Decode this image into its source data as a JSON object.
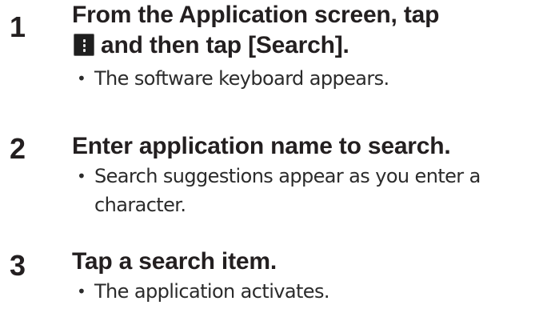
{
  "steps": [
    {
      "number": "1",
      "title_line_1": "From the Application screen, tap",
      "title_line_2_suffix": "and then tap [Search].",
      "icon": "menu-overflow-icon",
      "notes": [
        "The software keyboard appears."
      ]
    },
    {
      "number": "2",
      "title": "Enter application name to search.",
      "notes": [
        "Search suggestions appear as you enter a character."
      ]
    },
    {
      "number": "3",
      "title": "Tap a search item.",
      "notes": [
        "The application activates."
      ]
    }
  ],
  "bullet_glyph": "•"
}
